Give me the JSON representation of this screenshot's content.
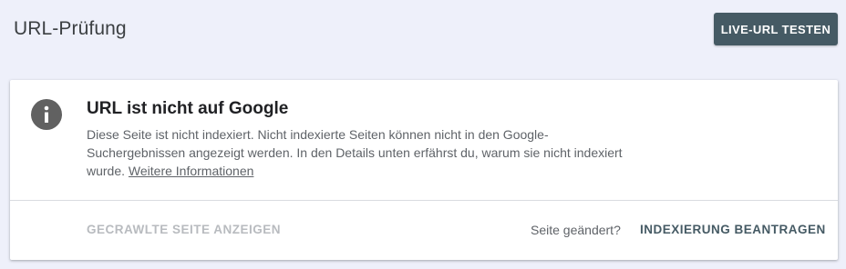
{
  "header": {
    "title": "URL-Prüfung",
    "live_test_label": "LIVE-URL TESTEN"
  },
  "status_card": {
    "icon": "info-icon",
    "heading": "URL ist nicht auf Google",
    "description": "Diese Seite ist nicht indexiert. Nicht indexierte Seiten können nicht in den Google-Suchergebnissen angezeigt werden. In den Details unten erfährst du, warum sie nicht indexiert wurde.",
    "learn_more_label": "Weitere Informationen",
    "view_crawled_label": "GECRAWLTE SEITE ANZEIGEN",
    "page_changed_label": "Seite geändert?",
    "request_indexing_label": "INDEXIERUNG BEANTRAGEN"
  },
  "colors": {
    "background": "#eef0fa",
    "primary_button": "#455a64",
    "icon_gray": "#616161"
  }
}
